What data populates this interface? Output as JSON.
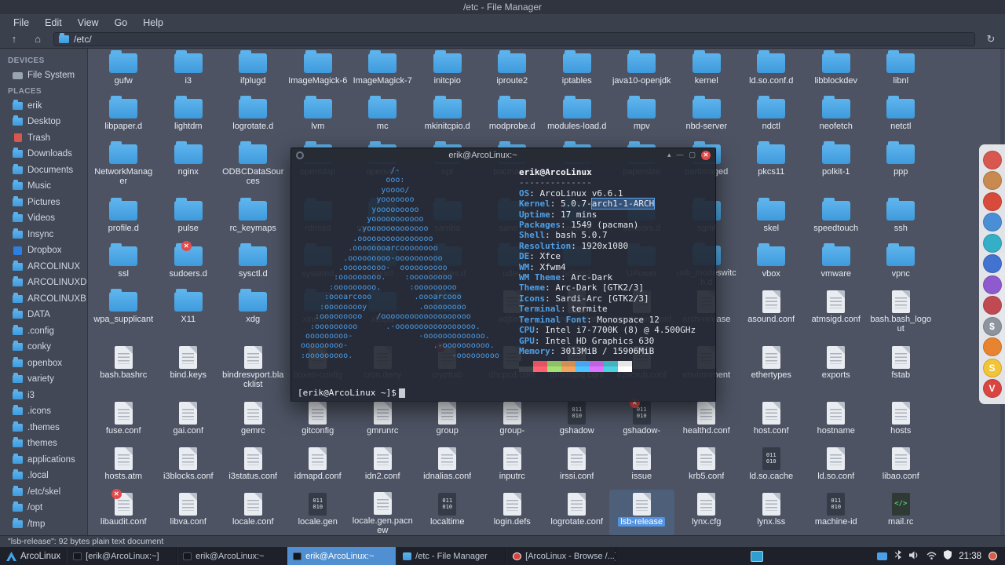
{
  "window": {
    "title": "/etc - File Manager"
  },
  "menubar": {
    "items": [
      "File",
      "Edit",
      "View",
      "Go",
      "Help"
    ]
  },
  "toolbar": {
    "path": "/etc/",
    "up_icon": "↑",
    "home_icon": "⌂",
    "reload_icon": "↻"
  },
  "sidebar": {
    "devices_header": "DEVICES",
    "devices": [
      {
        "label": "File System",
        "icon": "drive"
      }
    ],
    "places_header": "PLACES",
    "places": [
      {
        "label": "erik",
        "icon": "folder"
      },
      {
        "label": "Desktop",
        "icon": "folder"
      },
      {
        "label": "Trash",
        "icon": "trash"
      },
      {
        "label": "Downloads",
        "icon": "folder"
      },
      {
        "label": "Documents",
        "icon": "folder"
      },
      {
        "label": "Music",
        "icon": "folder"
      },
      {
        "label": "Pictures",
        "icon": "folder"
      },
      {
        "label": "Videos",
        "icon": "folder"
      },
      {
        "label": "Insync",
        "icon": "folder"
      },
      {
        "label": "Dropbox",
        "icon": "dropbox"
      },
      {
        "label": "ARCOLINUX",
        "icon": "folder"
      },
      {
        "label": "ARCOLINUXD",
        "icon": "folder"
      },
      {
        "label": "ARCOLINUXB",
        "icon": "folder"
      },
      {
        "label": "DATA",
        "icon": "folder"
      },
      {
        "label": ".config",
        "icon": "folder"
      },
      {
        "label": "conky",
        "icon": "folder"
      },
      {
        "label": "openbox",
        "icon": "folder"
      },
      {
        "label": "variety",
        "icon": "folder"
      },
      {
        "label": "i3",
        "icon": "folder"
      },
      {
        "label": ".icons",
        "icon": "folder"
      },
      {
        "label": ".themes",
        "icon": "folder"
      },
      {
        "label": "themes",
        "icon": "folder"
      },
      {
        "label": "applications",
        "icon": "folder"
      },
      {
        "label": ".local",
        "icon": "folder"
      },
      {
        "label": "/etc/skel",
        "icon": "folder"
      },
      {
        "label": "/opt",
        "icon": "folder"
      },
      {
        "label": "/tmp",
        "icon": "folder"
      }
    ]
  },
  "grid": {
    "rows": [
      [
        {
          "n": "gufw",
          "t": "f"
        },
        {
          "n": "i3",
          "t": "f"
        },
        {
          "n": "ifplugd",
          "t": "f"
        },
        {
          "n": "ImageMagick-6",
          "t": "f"
        },
        {
          "n": "ImageMagick-7",
          "t": "f"
        },
        {
          "n": "initcpio",
          "t": "f"
        },
        {
          "n": "iproute2",
          "t": "f"
        },
        {
          "n": "iptables",
          "t": "f"
        },
        {
          "n": "java10-openjdk",
          "t": "f"
        },
        {
          "n": "kernel",
          "t": "f"
        },
        {
          "n": "ld.so.conf.d",
          "t": "f"
        },
        {
          "n": "libblockdev",
          "t": "f"
        },
        {
          "n": "libnl",
          "t": "f"
        }
      ],
      [
        {
          "n": "libpaper.d",
          "t": "f"
        },
        {
          "n": "lightdm",
          "t": "f"
        },
        {
          "n": "logrotate.d",
          "t": "f"
        },
        {
          "n": "lvm",
          "t": "f"
        },
        {
          "n": "mc",
          "t": "f"
        },
        {
          "n": "mkinitcpio.d",
          "t": "f"
        },
        {
          "n": "modprobe.d",
          "t": "f"
        },
        {
          "n": "modules-load.d",
          "t": "f"
        },
        {
          "n": "mpv",
          "t": "f"
        },
        {
          "n": "nbd-server",
          "t": "f"
        },
        {
          "n": "ndctl",
          "t": "f"
        },
        {
          "n": "neofetch",
          "t": "f"
        },
        {
          "n": "netctl",
          "t": "f"
        }
      ],
      [
        {
          "n": "NetworkManager",
          "t": "f"
        },
        {
          "n": "nginx",
          "t": "f"
        },
        {
          "n": "ODBCDataSources",
          "t": "f"
        },
        {
          "n": "openldap",
          "t": "f"
        },
        {
          "n": "openvpn",
          "t": "f"
        },
        {
          "n": "opt",
          "t": "f"
        },
        {
          "n": "pacman.d",
          "t": "f"
        },
        {
          "n": "pam.d",
          "t": "f"
        },
        {
          "n": "papersize",
          "t": "f"
        },
        {
          "n": "partimaged",
          "t": "f"
        },
        {
          "n": "pkcs11",
          "t": "f"
        },
        {
          "n": "polkit-1",
          "t": "f"
        },
        {
          "n": "ppp",
          "t": "f"
        }
      ],
      [
        {
          "n": "profile.d",
          "t": "f"
        },
        {
          "n": "pulse",
          "t": "f"
        },
        {
          "n": "rc_keymaps",
          "t": "f"
        },
        {
          "n": "rdnssd",
          "t": "f"
        },
        {
          "n": "request-key.d",
          "t": "f"
        },
        {
          "n": "samba",
          "t": "f"
        },
        {
          "n": "sane.d",
          "t": "f"
        },
        {
          "n": "security",
          "t": "f"
        },
        {
          "n": "sensors.d",
          "t": "f"
        },
        {
          "n": "sgml",
          "t": "f"
        },
        {
          "n": "skel",
          "t": "f"
        },
        {
          "n": "speedtouch",
          "t": "f"
        },
        {
          "n": "ssh",
          "t": "f"
        }
      ],
      [
        {
          "n": "ssl",
          "t": "f"
        },
        {
          "n": "sudoers.d",
          "t": "f",
          "e": 1
        },
        {
          "n": "sysctl.d",
          "t": "f"
        },
        {
          "n": "systemd",
          "t": "f"
        },
        {
          "n": "texmf",
          "t": "f"
        },
        {
          "n": "tmpfiles.d",
          "t": "f"
        },
        {
          "n": "udev",
          "t": "f"
        },
        {
          "n": "udisks2",
          "t": "f"
        },
        {
          "n": "UPower",
          "t": "f"
        },
        {
          "n": "usb_modeswitch.d",
          "t": "f"
        },
        {
          "n": "vbox",
          "t": "f"
        },
        {
          "n": "vmware",
          "t": "f"
        },
        {
          "n": "vpnc",
          "t": "f"
        }
      ],
      [
        {
          "n": "wpa_supplicant",
          "t": "f"
        },
        {
          "n": "X11",
          "t": "f"
        },
        {
          "n": "xdg",
          "t": "f"
        },
        {
          "n": "xinetd.d",
          "t": "f"
        },
        {
          "n": "xl2tpd",
          "t": "f"
        },
        {
          "n": "zsh",
          "t": "f"
        },
        {
          "n": "adjtime",
          "t": "d"
        },
        {
          "n": "anacrontab",
          "t": "d"
        },
        {
          "n": "appstream.conf",
          "t": "d"
        },
        {
          "n": "arch-release",
          "t": "d"
        },
        {
          "n": "asound.conf",
          "t": "d"
        },
        {
          "n": "atmsigd.conf",
          "t": "d"
        },
        {
          "n": "bash.bash_logout",
          "t": "d"
        }
      ],
      [
        {
          "n": "bash.bashrc",
          "t": "d"
        },
        {
          "n": "bind.keys",
          "t": "d"
        },
        {
          "n": "bindresvport.blacklist",
          "t": "d"
        },
        {
          "n": "boxes-config",
          "t": "d"
        },
        {
          "n": "cron.deny",
          "t": "d"
        },
        {
          "n": "crypttab",
          "t": "d",
          "e": 1
        },
        {
          "n": "dhcpcd.conf",
          "t": "d"
        },
        {
          "n": "dnsmasq.conf",
          "t": "d"
        },
        {
          "n": "e2scrub.conf",
          "t": "d"
        },
        {
          "n": "environment",
          "t": "d"
        },
        {
          "n": "ethertypes",
          "t": "d"
        },
        {
          "n": "exports",
          "t": "d"
        },
        {
          "n": "fstab",
          "t": "d"
        }
      ],
      [
        {
          "n": "fuse.conf",
          "t": "d"
        },
        {
          "n": "gai.conf",
          "t": "d"
        },
        {
          "n": "gemrc",
          "t": "d"
        },
        {
          "n": "gitconfig",
          "t": "d"
        },
        {
          "n": "gmrunrc",
          "t": "d"
        },
        {
          "n": "group",
          "t": "d"
        },
        {
          "n": "group-",
          "t": "d"
        },
        {
          "n": "gshadow",
          "t": "b"
        },
        {
          "n": "gshadow-",
          "t": "b",
          "e": 1
        },
        {
          "n": "healthd.conf",
          "t": "d"
        },
        {
          "n": "host.conf",
          "t": "d"
        },
        {
          "n": "hostname",
          "t": "d"
        },
        {
          "n": "hosts",
          "t": "d"
        }
      ],
      [
        {
          "n": "hosts.atm",
          "t": "d"
        },
        {
          "n": "i3blocks.conf",
          "t": "d"
        },
        {
          "n": "i3status.conf",
          "t": "d"
        },
        {
          "n": "idmapd.conf",
          "t": "d"
        },
        {
          "n": "idn2.conf",
          "t": "d"
        },
        {
          "n": "idnalias.conf",
          "t": "d"
        },
        {
          "n": "inputrc",
          "t": "d"
        },
        {
          "n": "irssi.conf",
          "t": "d"
        },
        {
          "n": "issue",
          "t": "d"
        },
        {
          "n": "krb5.conf",
          "t": "d"
        },
        {
          "n": "ld.so.cache",
          "t": "b"
        },
        {
          "n": "ld.so.conf",
          "t": "d"
        },
        {
          "n": "libao.conf",
          "t": "d"
        }
      ],
      [
        {
          "n": "libaudit.conf",
          "t": "d",
          "e": 1
        },
        {
          "n": "libva.conf",
          "t": "d"
        },
        {
          "n": "locale.conf",
          "t": "d"
        },
        {
          "n": "locale.gen",
          "t": "b"
        },
        {
          "n": "locale.gen.pacnew",
          "t": "d"
        },
        {
          "n": "localtime",
          "t": "b"
        },
        {
          "n": "login.defs",
          "t": "d"
        },
        {
          "n": "logrotate.conf",
          "t": "d"
        },
        {
          "n": "lsb-release",
          "t": "d",
          "s": 1
        },
        {
          "n": "lynx.cfg",
          "t": "d"
        },
        {
          "n": "lynx.lss",
          "t": "d"
        },
        {
          "n": "machine-id",
          "t": "b"
        },
        {
          "n": "mail.rc",
          "t": "c"
        }
      ]
    ]
  },
  "terminal": {
    "title": "erik@ArcoLinux:~",
    "user_host": "erik@ArcoLinux",
    "separator": "--------------",
    "ascii": "                   /-\n                  ooo:\n                 yoooo/\n                yooooooo\n               yooooooooo\n              yooooooooooo\n            .yooooooooooooo\n           .oooooooooooooooo\n          .oooooooarcoooooooo\n         .ooooooooo-oooooooooo\n        .ooooooooo-  oooooooooo\n       :ooooooooo.    :ooooooooo\n      :ooooooooo.      :ooooooooo\n     :oooarcooo         .oooarcooo\n    :ooooooooy           .ooooooooo\n   :ooooooooo   /ooooooooooooooooooo\n  :ooooooooo      .-ooooooooooooooooo.\n ooooooooo-              -ooooooooooooo.\nooooooooo-                  .-oooooooooo.\n:ooooooooo.                     -ooooooooo",
    "info": [
      {
        "label": "OS",
        "value": "ArcoLinux v6.6.1"
      },
      {
        "label": "Kernel",
        "value": "5.0.7-arch1-1-ARCH",
        "highlight": "arch1-1-ARCH"
      },
      {
        "label": "Uptime",
        "value": "17 mins"
      },
      {
        "label": "Packages",
        "value": "1549 (pacman)"
      },
      {
        "label": "Shell",
        "value": "bash 5.0.7"
      },
      {
        "label": "Resolution",
        "value": "1920x1080"
      },
      {
        "label": "DE",
        "value": "Xfce"
      },
      {
        "label": "WM",
        "value": "Xfwm4"
      },
      {
        "label": "WM Theme",
        "value": "Arc-Dark"
      },
      {
        "label": "Theme",
        "value": "Arc-Dark [GTK2/3]"
      },
      {
        "label": "Icons",
        "value": "Sardi-Arc [GTK2/3]"
      },
      {
        "label": "Terminal",
        "value": "termite"
      },
      {
        "label": "Terminal Font",
        "value": "Monospace 12"
      },
      {
        "label": "CPU",
        "value": "Intel i7-7700K (8) @ 4.500GHz"
      },
      {
        "label": "GPU",
        "value": "Intel HD Graphics 630"
      },
      {
        "label": "Memory",
        "value": "3013MiB / 15906MiB"
      }
    ],
    "palette_row1": [
      "#262b33",
      "#e05561",
      "#8cc265",
      "#d18f52",
      "#4aa5f0",
      "#c162de",
      "#42b3c2",
      "#e6e6e6"
    ],
    "palette_row2": [
      "#394047",
      "#ff616e",
      "#a5e075",
      "#f0a45d",
      "#4dc4ff",
      "#de73ff",
      "#4cd1e0",
      "#ffffff"
    ],
    "prompt": "[erik@ArcoLinux ~]$",
    "minimize_icon": "—",
    "maximize_icon": "▢",
    "keep_above_icon": "▴",
    "close_icon": "✕"
  },
  "statusbar": {
    "text": "\"lsb-release\": 92 bytes plain text document"
  },
  "dock": {
    "icons": [
      {
        "name": "dock-app-1",
        "color": "#d8574f",
        "letter": ""
      },
      {
        "name": "dock-app-2",
        "color": "#c88a4e",
        "letter": ""
      },
      {
        "name": "dock-app-3",
        "color": "#d84b3a",
        "letter": ""
      },
      {
        "name": "dock-app-4",
        "color": "#4a8fd6",
        "letter": ""
      },
      {
        "name": "dock-app-5",
        "color": "#35aec8",
        "letter": ""
      },
      {
        "name": "dock-app-6",
        "color": "#4273d0",
        "letter": ""
      },
      {
        "name": "dock-app-7",
        "color": "#8e5ace",
        "letter": ""
      },
      {
        "name": "dock-app-8",
        "color": "#c04a52",
        "letter": ""
      },
      {
        "name": "dock-app-9",
        "color": "#8e949e",
        "letter": "$"
      },
      {
        "name": "dock-app-10",
        "color": "#e8842f",
        "letter": ""
      },
      {
        "name": "dock-app-11",
        "color": "#f2c437",
        "letter": "S"
      },
      {
        "name": "dock-app-12",
        "color": "#d94540",
        "letter": "V"
      }
    ]
  },
  "taskbar": {
    "launcher_label": "ArcoLinux",
    "windows": [
      {
        "label": "[erik@ArcoLinux:~]",
        "icon": "terminal",
        "active": false
      },
      {
        "label": "erik@ArcoLinux:~",
        "icon": "terminal",
        "active": false
      },
      {
        "label": "erik@ArcoLinux:~",
        "icon": "terminal",
        "active": true
      },
      {
        "label": "/etc - File Manager",
        "icon": "filemanager",
        "active": false
      },
      {
        "label": "[ArcoLinux - Browse /...]",
        "icon": "browser",
        "active": false
      }
    ],
    "clock": "21:38"
  }
}
